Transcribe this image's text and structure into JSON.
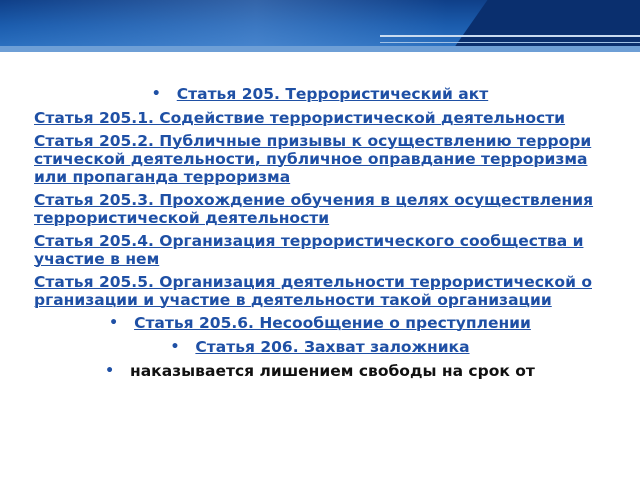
{
  "slide": {
    "items": [
      {
        "text": "Статья 205. Террористический акт",
        "style": "bullet-center"
      },
      {
        "text": "Статья 205.1. Содействие террористической деятельности",
        "style": "plain"
      },
      {
        "text": "Статья 205.2. Публичные призывы к осуществлению террористической деятельности, публичное оправдание терроризма или пропаганда терроризма",
        "style": "plain"
      },
      {
        "text": "Статья 205.3. Прохождение обучения в целях осуществления террористической деятельности",
        "style": "plain"
      },
      {
        "text": "Статья 205.4. Организация террористического сообщества и участие в нем",
        "style": "plain"
      },
      {
        "text": "Статья 205.5. Организация деятельности террористической организации и участие в деятельности такой организации",
        "style": "plain"
      },
      {
        "text": "Статья 205.6. Несообщение о преступлении",
        "style": "bullet-center"
      },
      {
        "text": "Статья 206. Захват заложника",
        "style": "bullet-center"
      }
    ],
    "note": "наказывается лишением свободы на срок от",
    "bullet_glyph": "•"
  },
  "colors": {
    "link": "#1f50a5",
    "header": "#1b5cad",
    "text": "#111111"
  }
}
